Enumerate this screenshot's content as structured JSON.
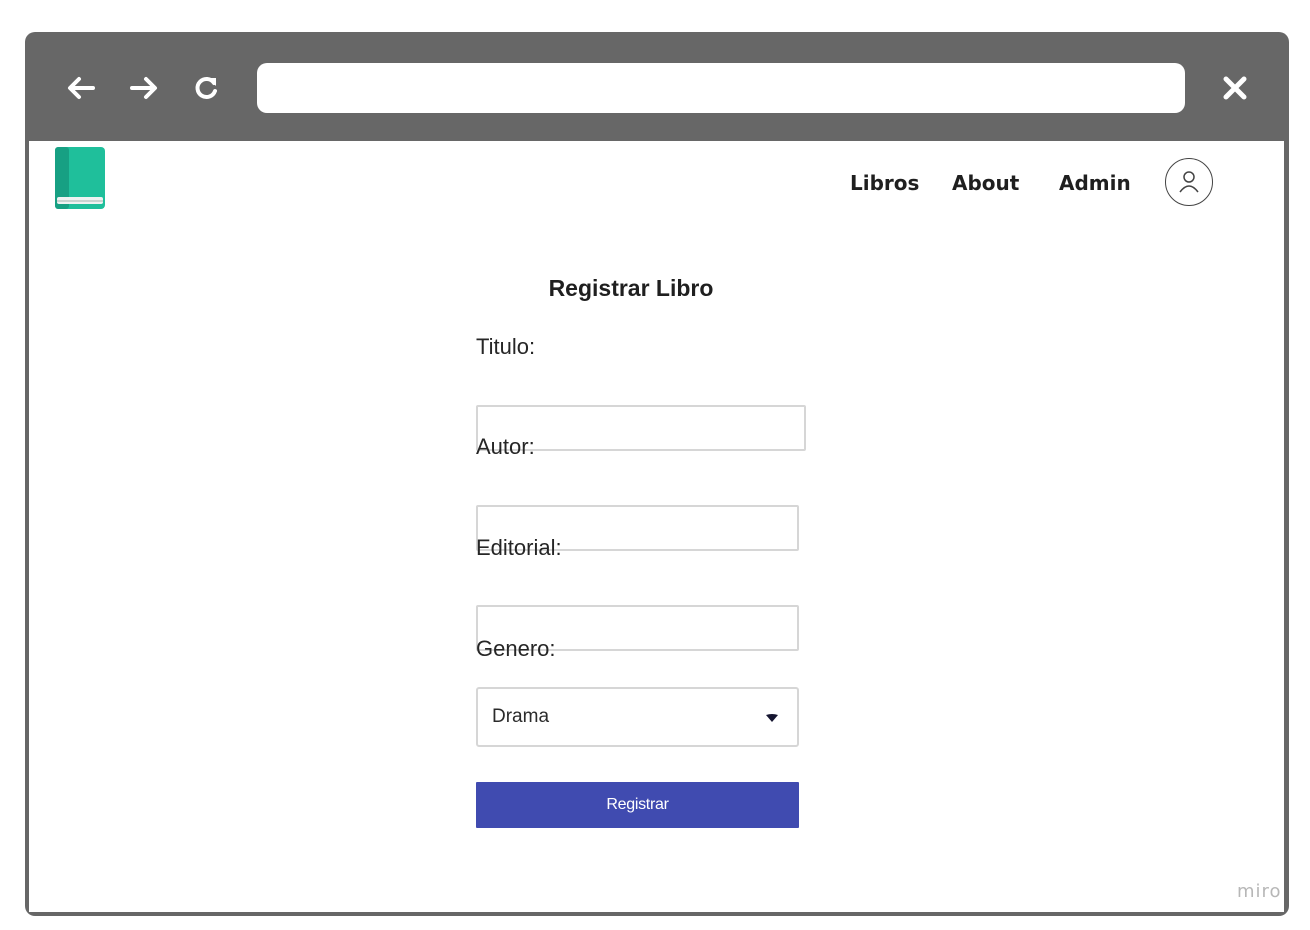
{
  "browser": {
    "address_value": "",
    "nav_icons": [
      "back-arrow-icon",
      "forward-arrow-icon",
      "reload-icon"
    ],
    "close_icon": "close-icon",
    "frame_color": "#676767"
  },
  "header": {
    "logo_icon": "book-icon",
    "nav_items": [
      {
        "label": "Libros"
      },
      {
        "label": "About"
      },
      {
        "label": "Admin"
      }
    ],
    "avatar_icon": "user-icon"
  },
  "form": {
    "title": "Registrar Libro",
    "fields": [
      {
        "label": "Titulo:",
        "value": ""
      },
      {
        "label": "Autor:",
        "value": ""
      },
      {
        "label": "Editorial:",
        "value": ""
      }
    ],
    "genre": {
      "label": "Genero:",
      "selected": "Drama",
      "caret_icon": "caret-down-icon"
    },
    "submit_label": "Registrar",
    "submit_color": "#404bb0"
  },
  "watermark": "miro",
  "colors": {
    "logo_primary": "#1fbf9b",
    "logo_dark": "#17a083",
    "text": "#1f1f1f"
  }
}
